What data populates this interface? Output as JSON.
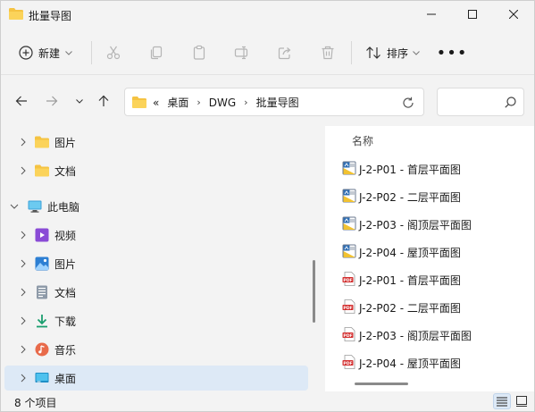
{
  "window": {
    "title": "批量导图"
  },
  "toolbar": {
    "new_label": "新建",
    "sort_label": "排序",
    "more_label": "•••"
  },
  "address": {
    "overflow": "«",
    "crumbs": [
      "桌面",
      "DWG",
      "批量导图"
    ]
  },
  "nav": {
    "items": [
      {
        "label": "图片",
        "icon": "folder-icon"
      },
      {
        "label": "文档",
        "icon": "folder-icon"
      },
      {
        "label": "此电脑",
        "icon": "computer-icon"
      },
      {
        "label": "视频",
        "icon": "video-icon"
      },
      {
        "label": "图片",
        "icon": "pictures-icon"
      },
      {
        "label": "文档",
        "icon": "document-icon"
      },
      {
        "label": "下载",
        "icon": "download-icon"
      },
      {
        "label": "音乐",
        "icon": "music-icon"
      },
      {
        "label": "桌面",
        "icon": "desktop-icon"
      }
    ]
  },
  "files": {
    "column_name": "名称",
    "items": [
      {
        "name": "J-2-P01 - 首层平面图",
        "type": "dwg"
      },
      {
        "name": "J-2-P02 - 二层平面图",
        "type": "dwg"
      },
      {
        "name": "J-2-P03 - 阁顶层平面图",
        "type": "dwg"
      },
      {
        "name": "J-2-P04 - 屋顶平面图",
        "type": "dwg"
      },
      {
        "name": "J-2-P01 - 首层平面图",
        "type": "pdf"
      },
      {
        "name": "J-2-P02 - 二层平面图",
        "type": "pdf"
      },
      {
        "name": "J-2-P03 - 阁顶层平面图",
        "type": "pdf"
      },
      {
        "name": "J-2-P04 - 屋顶平面图",
        "type": "pdf"
      }
    ]
  },
  "status": {
    "count_text": "8 个项目"
  },
  "colors": {
    "accent": "#0067c0",
    "folder": "#f5c342",
    "pdf": "#d32f2f",
    "selection": "#dde9f6"
  }
}
